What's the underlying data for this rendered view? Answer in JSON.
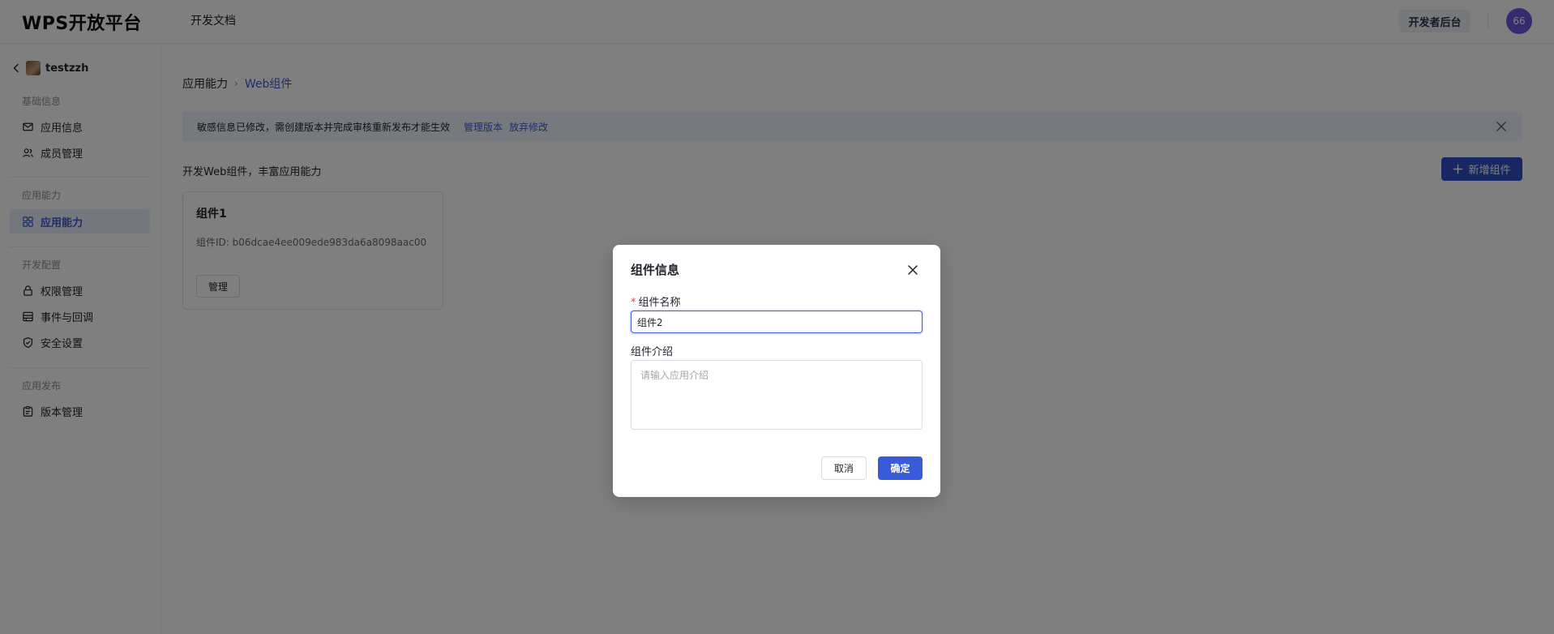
{
  "header": {
    "logo": "WPS开放平台",
    "nav_doc": "开发文档",
    "dev_console": "开发者后台",
    "avatar_text": "66"
  },
  "sidebar": {
    "app_name": "testzzh",
    "groups": [
      {
        "title": "基础信息",
        "items": [
          {
            "label": "应用信息",
            "icon": "mail-icon"
          },
          {
            "label": "成员管理",
            "icon": "users-icon"
          }
        ]
      },
      {
        "title": "应用能力",
        "items": [
          {
            "label": "应用能力",
            "icon": "grid-icon",
            "active": true
          }
        ]
      },
      {
        "title": "开发配置",
        "items": [
          {
            "label": "权限管理",
            "icon": "lock-icon"
          },
          {
            "label": "事件与回调",
            "icon": "event-icon"
          },
          {
            "label": "安全设置",
            "icon": "shield-icon"
          }
        ]
      },
      {
        "title": "应用发布",
        "items": [
          {
            "label": "版本管理",
            "icon": "clipboard-icon"
          }
        ]
      }
    ]
  },
  "main": {
    "breadcrumb": {
      "root": "应用能力",
      "separator": "›",
      "current": "Web组件"
    },
    "banner": {
      "text": "敏感信息已修改，需创建版本并完成审核重新发布才能生效",
      "link_manage": "管理版本",
      "link_discard": "放弃修改"
    },
    "intro": "开发Web组件，丰富应用能力",
    "add_button": "新增组件",
    "card": {
      "title": "组件1",
      "id_text": "组件ID: b06dcae4ee009ede983da6a8098aac00",
      "manage_button": "管理"
    }
  },
  "modal": {
    "title": "组件信息",
    "name_label": "组件名称",
    "name_required_mark": "*",
    "name_value": "组件2",
    "desc_label": "组件介绍",
    "desc_placeholder": "请输入应用介绍",
    "cancel": "取消",
    "confirm": "确定"
  },
  "colors": {
    "primary": "#3a5bd9",
    "primary_dark": "#2c4fc9",
    "banner_bg": "#edf3fd",
    "active_bg": "#e8eefc"
  }
}
